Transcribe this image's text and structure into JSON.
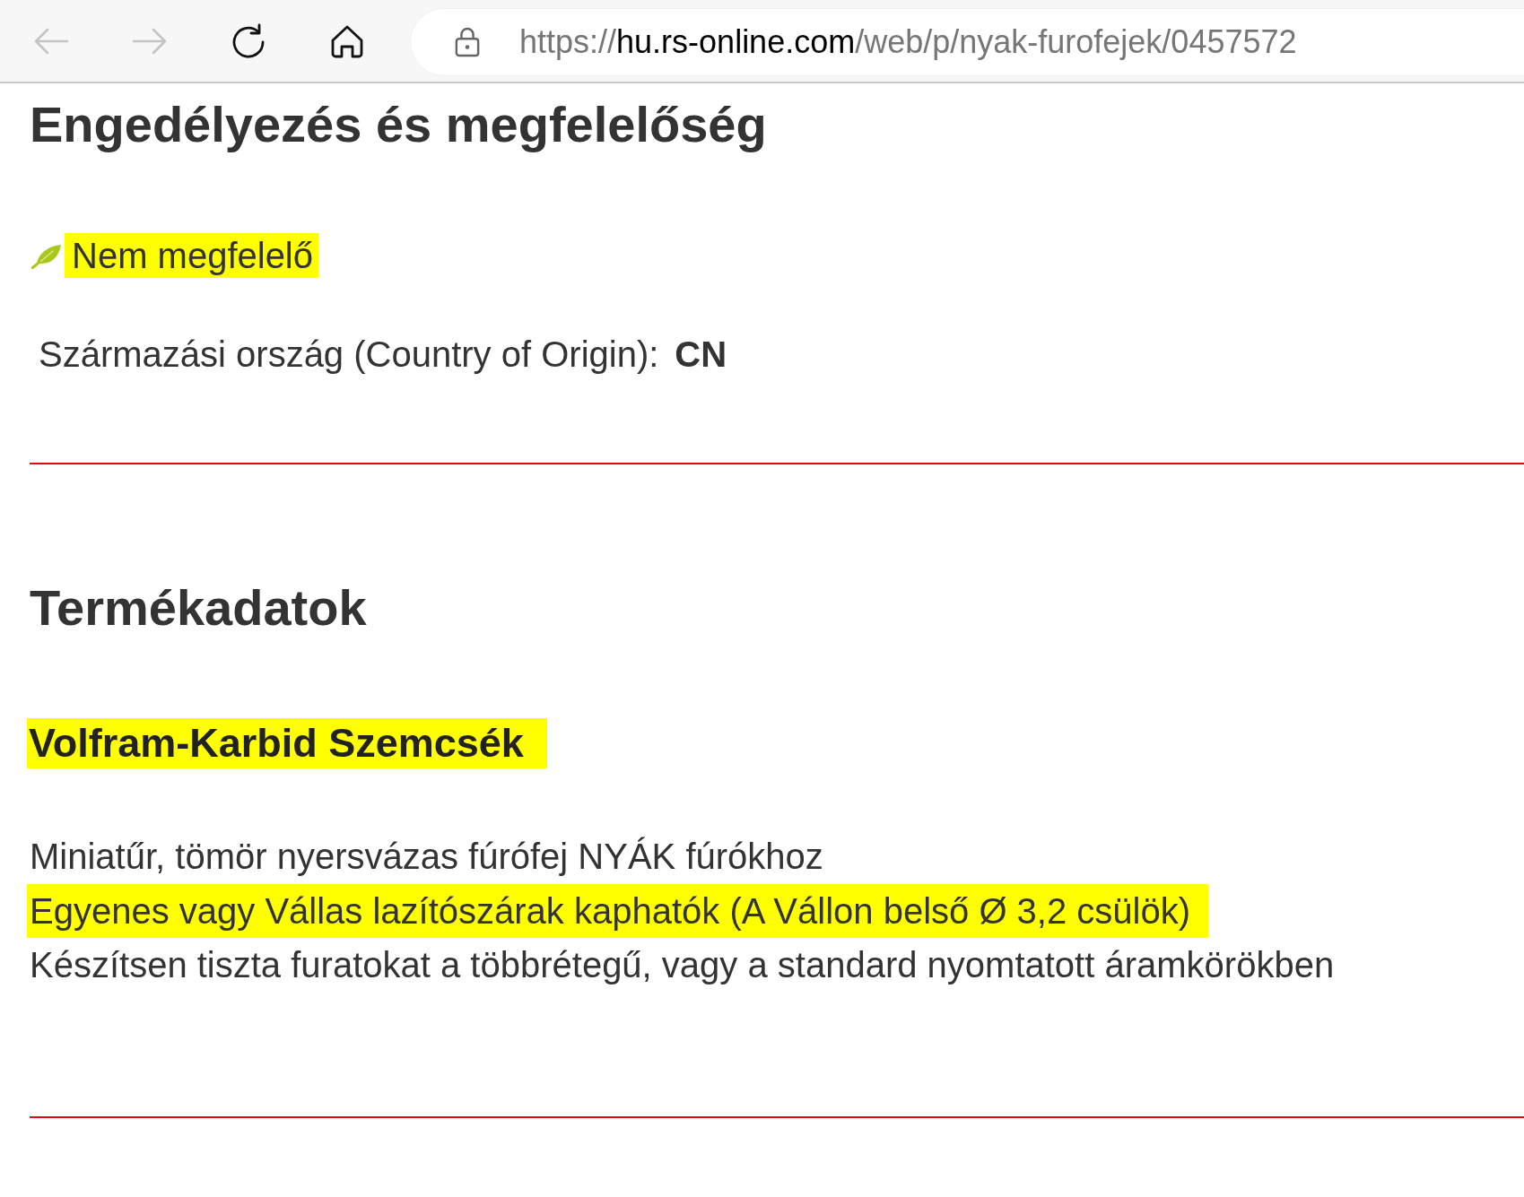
{
  "toolbar": {
    "nav_buttons": [
      {
        "kind": "back",
        "disabled": true
      },
      {
        "kind": "forward",
        "disabled": true
      },
      {
        "kind": "reload",
        "disabled": false
      },
      {
        "kind": "home",
        "disabled": false
      }
    ],
    "address": {
      "scheme": "https://",
      "host": "hu.rs-online.com",
      "path": "/web/p/nyak-furofejek/0457572"
    }
  },
  "approval_section": {
    "heading": "Engedélyezés és megfelelőség",
    "compliance": {
      "label": "Nem megfelelő",
      "highlighted": true
    },
    "origin": {
      "label": "Származási ország (Country of Origin):",
      "value": "CN"
    }
  },
  "product_section": {
    "heading": "Termékadatok",
    "subheading": {
      "text": "Volfram-Karbid Szemcsék",
      "highlighted": true
    },
    "lines": [
      {
        "text": "Miniatűr, tömör nyersvázas fúrófej NYÁK fúrókhoz",
        "highlighted": false
      },
      {
        "text": "Egyenes vagy Vállas lazítószárak kaphatók (A Vállon belső Ø 3,2 csülök)",
        "highlighted": true
      },
      {
        "text": "Készítsen tiszta furatokat a többrétegű, vagy a standard nyomtatott áramkörökben",
        "highlighted": false
      }
    ]
  }
}
